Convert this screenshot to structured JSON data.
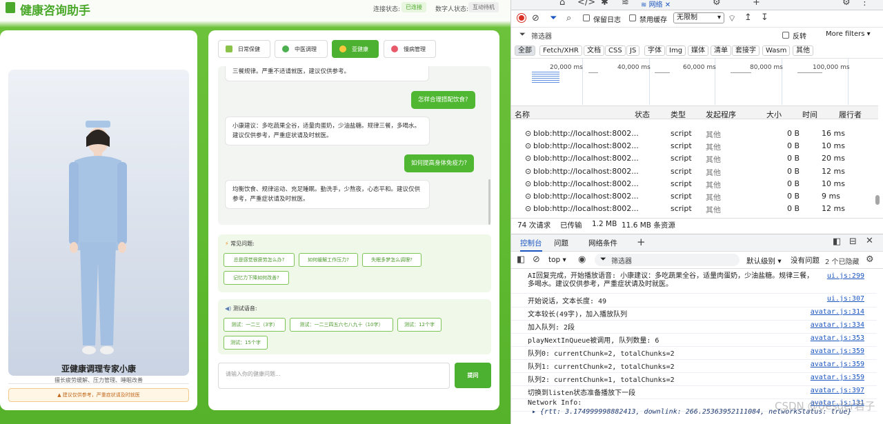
{
  "app": {
    "title": "健康咨询助手",
    "conn_label": "连接状态:",
    "conn_value": "已连接",
    "dh_label": "数字人状态:",
    "dh_value": "互动待机",
    "avatar": {
      "name": "亚健康调理专家小康",
      "subtitle": "擅长疲劳缓解、压力管理、睡眠改善",
      "warning": "建议仅供参考，严重症状请及时就医"
    },
    "tabs": [
      {
        "label": "日常保健"
      },
      {
        "label": "中医调理"
      },
      {
        "label": "亚健康"
      },
      {
        "label": "慢病管理"
      }
    ],
    "messages": [
      {
        "role": "bot",
        "text": "三餐规律。严重不适请就医，建议仅供参考。"
      },
      {
        "role": "user",
        "text": "怎样合理搭配饮食?"
      },
      {
        "role": "bot",
        "text": "小康建议：多吃蔬果全谷，适量肉蛋奶，少油盐糖。规律三餐，多喝水。建议仅供参考，严重症状请及时就医。"
      },
      {
        "role": "user",
        "text": "如何提高身体免疫力?"
      },
      {
        "role": "bot",
        "text": "均衡饮食、规律运动、充足睡眠。勤洗手，少熬夜，心态平和。建议仅供参考，严重症状请及时就医。"
      }
    ],
    "faq": {
      "title": "常见问题:",
      "items": [
        "总是感觉很疲劳怎么办?",
        "如何缓解工作压力?",
        "失眠多梦怎么调理?",
        "记忆力下降如何改善?"
      ]
    },
    "voice": {
      "title": "测试语音:",
      "items": [
        "测试：一二三（3字）",
        "测试：一二三四五六七八九十（10字）",
        "测试：12个字",
        "测试：15个字"
      ]
    },
    "input_placeholder": "请输入你的健康问题...",
    "send_label": "提问"
  },
  "devtools": {
    "tabs": [
      "网络"
    ],
    "preserve_log": "保留日志",
    "disable_cache": "禁用缓存",
    "throttle": "无限制",
    "filter_placeholder": "筛选器",
    "invert": "反转",
    "more_filters": "More filters",
    "type_filters": [
      "全部",
      "Fetch/XHR",
      "文档",
      "CSS",
      "JS",
      "字体",
      "Img",
      "媒体",
      "清单",
      "套接字",
      "Wasm",
      "其他"
    ],
    "timeline_ticks": [
      "20,000 ms",
      "40,000 ms",
      "60,000 ms",
      "80,000 ms",
      "100,000 ms"
    ],
    "columns": [
      "名称",
      "状态",
      "类型",
      "发起程序",
      "大小",
      "时间",
      "履行者"
    ],
    "rows": [
      {
        "name": "blob:http://localhost:8002...",
        "type": "script",
        "initiator": "其他",
        "size": "0 B",
        "time": "16 ms"
      },
      {
        "name": "blob:http://localhost:8002...",
        "type": "script",
        "initiator": "其他",
        "size": "0 B",
        "time": "10 ms"
      },
      {
        "name": "blob:http://localhost:8002...",
        "type": "script",
        "initiator": "其他",
        "size": "0 B",
        "time": "20 ms"
      },
      {
        "name": "blob:http://localhost:8002...",
        "type": "script",
        "initiator": "其他",
        "size": "0 B",
        "time": "12 ms"
      },
      {
        "name": "blob:http://localhost:8002...",
        "type": "script",
        "initiator": "其他",
        "size": "0 B",
        "time": "10 ms"
      },
      {
        "name": "blob:http://localhost:8002...",
        "type": "script",
        "initiator": "其他",
        "size": "0 B",
        "time": "9 ms"
      },
      {
        "name": "blob:http://localhost:8002...",
        "type": "script",
        "initiator": "其他",
        "size": "0 B",
        "time": "12 ms"
      }
    ],
    "summary": [
      "74 次请求",
      "已传输",
      "1.2 MB",
      "11.6 MB 条资源"
    ],
    "drawer_tabs": [
      "控制台",
      "问题",
      "网络条件"
    ],
    "console_context": "top",
    "console_filter": "筛选器",
    "level": "默认级别",
    "no_issues": "没有问题",
    "hidden": "2 个已隐藏",
    "logs": [
      {
        "text": "AI回复完成，开始播放语音: 小康建议：多吃蔬果全谷，适量肉蛋奶，少油盐糖。规律三餐，多喝水。建议仅供参考，严重症状请及时就医。",
        "src": "ui.js:299"
      },
      {
        "text": "开始说话，文本长度: 49",
        "src": "ui.js:307"
      },
      {
        "text": "文本较长(49字)，加入播放队列",
        "src": "avatar.js:314"
      },
      {
        "text": "加入队列: 2段",
        "src": "avatar.js:334"
      },
      {
        "text": "playNextInQueue被调用, 队列数量: 6",
        "src": "avatar.js:353"
      },
      {
        "text": "队列0: currentChunk=2, totalChunks=2",
        "src": "avatar.js:359"
      },
      {
        "text": "队列1: currentChunk=2, totalChunks=2",
        "src": "avatar.js:359"
      },
      {
        "text": "队列2: currentChunk=1, totalChunks=2",
        "src": "avatar.js:359"
      },
      {
        "text": "切换到listen状态准备播放下一段",
        "src": "avatar.js:397"
      },
      {
        "text": "Network Info:",
        "src": "avatar.js:131"
      },
      {
        "text": "▸ {rtt: 3.174999998882413, downlink: 266.25363952111084, networkStatus: true}",
        "src": ""
      }
    ],
    "watermark": "CSDN @Uesder君子"
  }
}
